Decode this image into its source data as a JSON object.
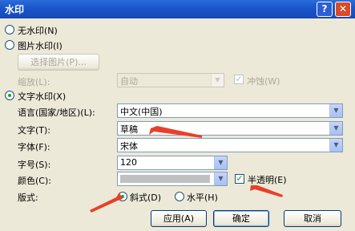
{
  "window": {
    "title": "水印",
    "help_label": "?",
    "close_label": "✕"
  },
  "options": {
    "no_watermark": "无水印(N)",
    "picture_watermark": "图片水印(I)",
    "select_picture_button": "选择图片(P)...",
    "scale_label": "缩放(L):",
    "scale_value": "自动",
    "washout_label": "冲蚀(W)",
    "text_watermark": "文字水印(X)"
  },
  "fields": {
    "language_label": "语言(国家/地区)(L):",
    "language_value": "中文(中国)",
    "text_label": "文字(T):",
    "text_value": "草稿",
    "font_label": "字体(F):",
    "font_value": "宋体",
    "size_label": "字号(S):",
    "size_value": "120",
    "color_label": "颜色(C):",
    "color_value": "",
    "semi_transparent_label": "半透明(E)",
    "layout_label": "版式:",
    "diagonal_label": "斜式(D)",
    "horizontal_label": "水平(H)"
  },
  "buttons": {
    "apply": "应用(A)",
    "ok": "确定",
    "cancel": "取消"
  },
  "colors": {
    "title_bar": "#1a55c9",
    "annotation_arrow": "#e8402a",
    "color_swatch": "#c0c0c0"
  }
}
